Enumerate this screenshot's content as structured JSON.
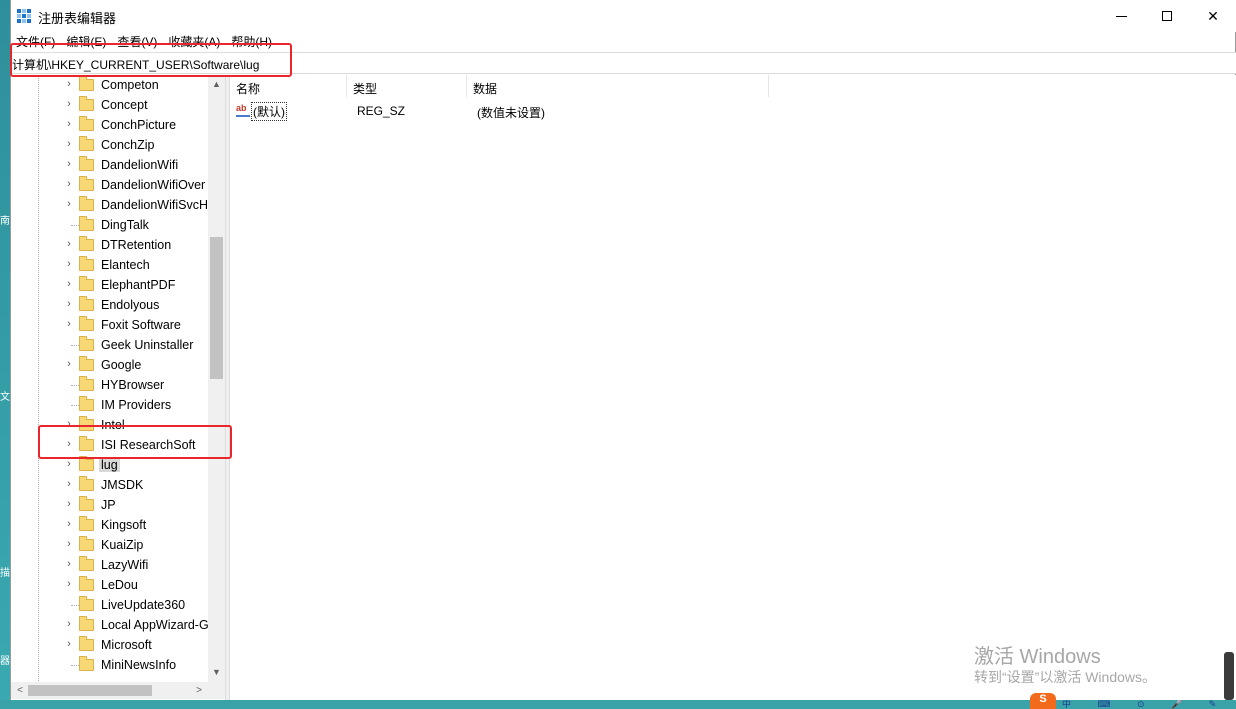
{
  "window": {
    "title": "注册表编辑器",
    "controls": {
      "minimize": "—",
      "maximize": "☐",
      "close": "✕"
    }
  },
  "menu": [
    "文件(F)",
    "编辑(E)",
    "查看(V)",
    "收藏夹(A)",
    "帮助(H)"
  ],
  "address": "计算机\\HKEY_CURRENT_USER\\Software\\lug",
  "tree": {
    "items": [
      {
        "label": "Competon",
        "expandable": true
      },
      {
        "label": "Concept",
        "expandable": true
      },
      {
        "label": "ConchPicture",
        "expandable": true
      },
      {
        "label": "ConchZip",
        "expandable": true
      },
      {
        "label": "DandelionWifi",
        "expandable": true
      },
      {
        "label": "DandelionWifiOver",
        "expandable": true
      },
      {
        "label": "DandelionWifiSvcH",
        "expandable": true
      },
      {
        "label": "DingTalk",
        "expandable": false
      },
      {
        "label": "DTRetention",
        "expandable": true
      },
      {
        "label": "Elantech",
        "expandable": true
      },
      {
        "label": "ElephantPDF",
        "expandable": true
      },
      {
        "label": "Endolyous",
        "expandable": true
      },
      {
        "label": "Foxit Software",
        "expandable": true
      },
      {
        "label": "Geek Uninstaller",
        "expandable": false
      },
      {
        "label": "Google",
        "expandable": true
      },
      {
        "label": "HYBrowser",
        "expandable": false
      },
      {
        "label": "IM Providers",
        "expandable": false
      },
      {
        "label": "Intel",
        "expandable": true
      },
      {
        "label": "ISI ResearchSoft",
        "expandable": true
      },
      {
        "label": "lug",
        "expandable": true,
        "selected": true
      },
      {
        "label": "JMSDK",
        "expandable": true
      },
      {
        "label": "JP",
        "expandable": true
      },
      {
        "label": "Kingsoft",
        "expandable": true
      },
      {
        "label": "KuaiZip",
        "expandable": true
      },
      {
        "label": "LazyWifi",
        "expandable": true
      },
      {
        "label": "LeDou",
        "expandable": true
      },
      {
        "label": "LiveUpdate360",
        "expandable": false
      },
      {
        "label": "Local AppWizard-G",
        "expandable": true
      },
      {
        "label": "Microsoft",
        "expandable": true
      },
      {
        "label": "MiniNewsInfo",
        "expandable": false
      }
    ]
  },
  "list": {
    "columns": [
      "名称",
      "类型",
      "数据"
    ],
    "rows": [
      {
        "name": "(默认)",
        "type": "REG_SZ",
        "data": "(数值未设置)"
      }
    ]
  },
  "watermark": {
    "line1": "激活 Windows",
    "line2": "转到“设置”以激活 Windows。"
  },
  "desktop_glyphs": [
    "南",
    "文",
    "描",
    "器"
  ],
  "tray": {
    "logo": "S",
    "icons": "中 ⌨ ⊙ 🎤 ✎ ⚙"
  },
  "colors": {
    "highlight": "#e8262b",
    "folder": "#f8d775",
    "desktop": "#3aa2a9"
  }
}
